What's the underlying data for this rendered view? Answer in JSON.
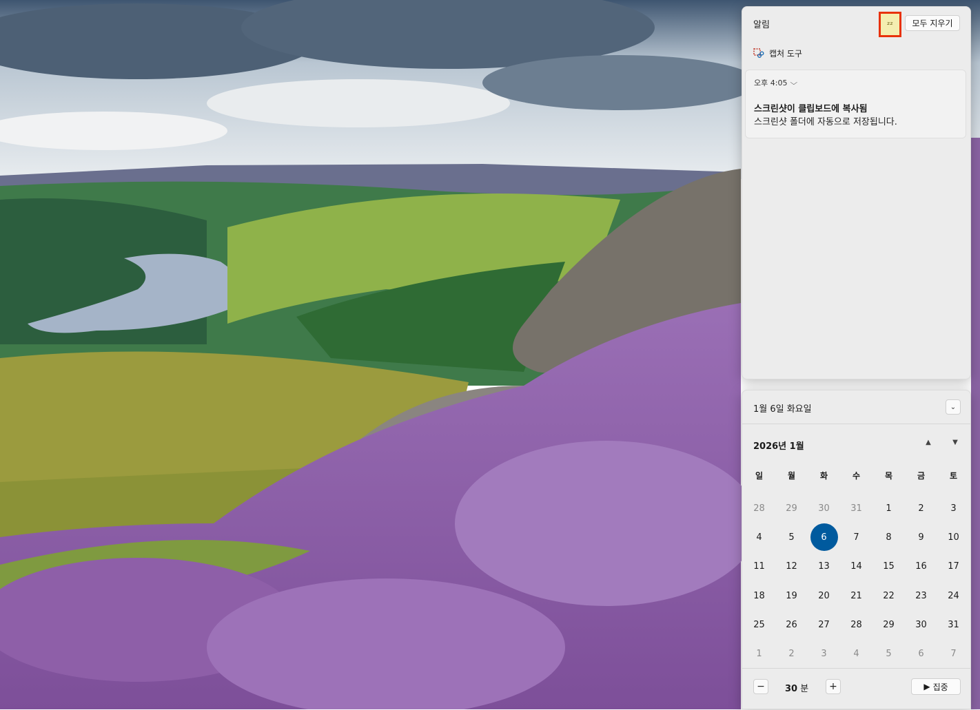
{
  "notifications": {
    "title": "알림",
    "dnd_icon": "dnd-zz-icon",
    "clear_all_label": "모두 지우기",
    "app_group": {
      "icon": "snipping-tool-icon",
      "name": "캡처 도구"
    },
    "card": {
      "time": "오후 4:05",
      "title": "스크린샷이 클립보드에 복사됨",
      "body": "스크린샷 폴더에 자동으로 저장됩니다."
    }
  },
  "calendar": {
    "date_label": "1월 6일 화요일",
    "month_label": "2026년 1월",
    "weekdays": [
      "일",
      "월",
      "화",
      "수",
      "목",
      "금",
      "토"
    ],
    "days": [
      {
        "d": "28",
        "dim": true
      },
      {
        "d": "29",
        "dim": true
      },
      {
        "d": "30",
        "dim": true
      },
      {
        "d": "31",
        "dim": true
      },
      {
        "d": "1"
      },
      {
        "d": "2"
      },
      {
        "d": "3"
      },
      {
        "d": "4"
      },
      {
        "d": "5"
      },
      {
        "d": "6",
        "today": true
      },
      {
        "d": "7"
      },
      {
        "d": "8"
      },
      {
        "d": "9"
      },
      {
        "d": "10"
      },
      {
        "d": "11"
      },
      {
        "d": "12"
      },
      {
        "d": "13"
      },
      {
        "d": "14"
      },
      {
        "d": "15"
      },
      {
        "d": "16"
      },
      {
        "d": "17"
      },
      {
        "d": "18"
      },
      {
        "d": "19"
      },
      {
        "d": "20"
      },
      {
        "d": "21"
      },
      {
        "d": "22"
      },
      {
        "d": "23"
      },
      {
        "d": "24"
      },
      {
        "d": "25"
      },
      {
        "d": "26"
      },
      {
        "d": "27"
      },
      {
        "d": "28"
      },
      {
        "d": "29"
      },
      {
        "d": "30"
      },
      {
        "d": "31"
      },
      {
        "d": "1",
        "dim": true
      },
      {
        "d": "2",
        "dim": true
      },
      {
        "d": "3",
        "dim": true
      },
      {
        "d": "4",
        "dim": true
      },
      {
        "d": "5",
        "dim": true
      },
      {
        "d": "6",
        "dim": true
      },
      {
        "d": "7",
        "dim": true
      }
    ],
    "focus": {
      "minutes": "30",
      "unit": "분",
      "minus": "−",
      "plus": "+",
      "start_label": "집중"
    }
  },
  "colors": {
    "today": "#005a9e",
    "highlight_border": "#e8320a"
  }
}
